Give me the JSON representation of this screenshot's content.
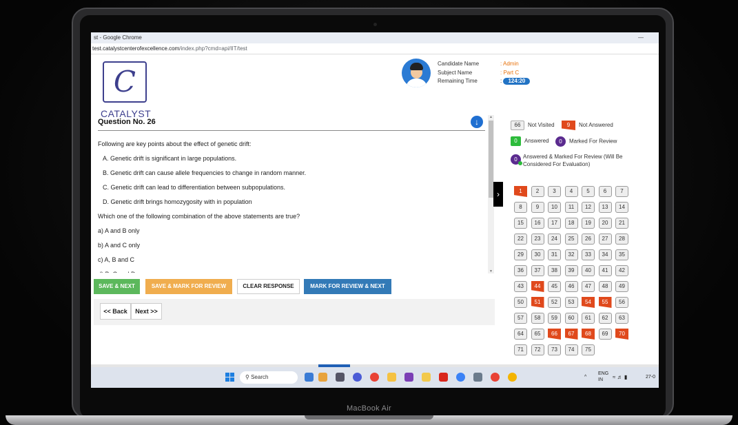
{
  "device_label": "MacBook Air",
  "browser": {
    "window_title": "st - Google Chrome",
    "minimize_glyph": "—",
    "url_host": "test.catalystcenterofexcellence.com",
    "url_path": "/index.php?cmd=api/IIT/test"
  },
  "header": {
    "logo_glyph": "C",
    "logo_text": "CATALYST",
    "candidate_label": "Candidate Name",
    "subject_label": "Subject Name",
    "time_label": "Remaining Time",
    "candidate_value": ": Admin",
    "subject_value": ": Part C",
    "time_colon": ":",
    "time_value": "124:20"
  },
  "question": {
    "title": "Question No. 26",
    "stem": "Following are key points about the effect of genetic drift:",
    "statements": [
      "A.  Genetic drift is significant in large populations.",
      "B.  Genetic drift can cause allele frequencies to change in random manner.",
      "C.  Genetic drift can lead to differentiation between subpopulations.",
      "D.  Genetic drift brings homozygosity with in population"
    ],
    "prompt": "Which one of the following combination of the above statements are true?",
    "options": [
      "a) A and B only",
      "b) A and C only",
      "c) A, B and C",
      "d) B, C and D"
    ]
  },
  "actions": {
    "save_next": "SAVE & NEXT",
    "save_mark": "SAVE & MARK FOR REVIEW",
    "clear": "CLEAR RESPONSE",
    "mark_next": "MARK FOR REVIEW & NEXT",
    "back": "<< Back",
    "next": "Next >>"
  },
  "legend": {
    "not_visited_count": "66",
    "not_visited_label": "Not Visited",
    "not_answered_count": "9",
    "not_answered_label": "Not Answered",
    "answered_count": "0",
    "answered_label": "Answered",
    "marked_count": "0",
    "marked_label": "Marked For Review",
    "answered_marked_count": "0",
    "answered_marked_label": "Answered & Marked For Review (Will Be Considered For Evaluation)"
  },
  "palette": {
    "not_answered": [
      "1",
      "44",
      "51",
      "54",
      "55",
      "66",
      "67",
      "68",
      "70"
    ],
    "questions": [
      "1",
      "2",
      "3",
      "4",
      "5",
      "6",
      "7",
      "8",
      "9",
      "10",
      "11",
      "12",
      "13",
      "14",
      "15",
      "16",
      "17",
      "18",
      "19",
      "20",
      "21",
      "22",
      "23",
      "24",
      "25",
      "26",
      "27",
      "28",
      "29",
      "30",
      "31",
      "32",
      "33",
      "34",
      "35",
      "36",
      "37",
      "38",
      "39",
      "40",
      "41",
      "42",
      "43",
      "44",
      "45",
      "46",
      "47",
      "48",
      "49",
      "50",
      "51",
      "52",
      "53",
      "54",
      "55",
      "56",
      "57",
      "58",
      "59",
      "60",
      "61",
      "62",
      "63",
      "64",
      "65",
      "66",
      "67",
      "68",
      "69",
      "70",
      "71",
      "72",
      "73",
      "74",
      "75"
    ]
  },
  "taskbar": {
    "search_label": "Search",
    "lang_top": "ENG",
    "lang_bottom": "IN",
    "date_partial": "27-0"
  },
  "colors": {
    "not_answered": "#e0491c",
    "answered": "#2dbb3b",
    "marked": "#5b2b8f",
    "save_next": "#5cb85c",
    "save_mark": "#f0ad4e",
    "mark_next": "#337ab7"
  }
}
